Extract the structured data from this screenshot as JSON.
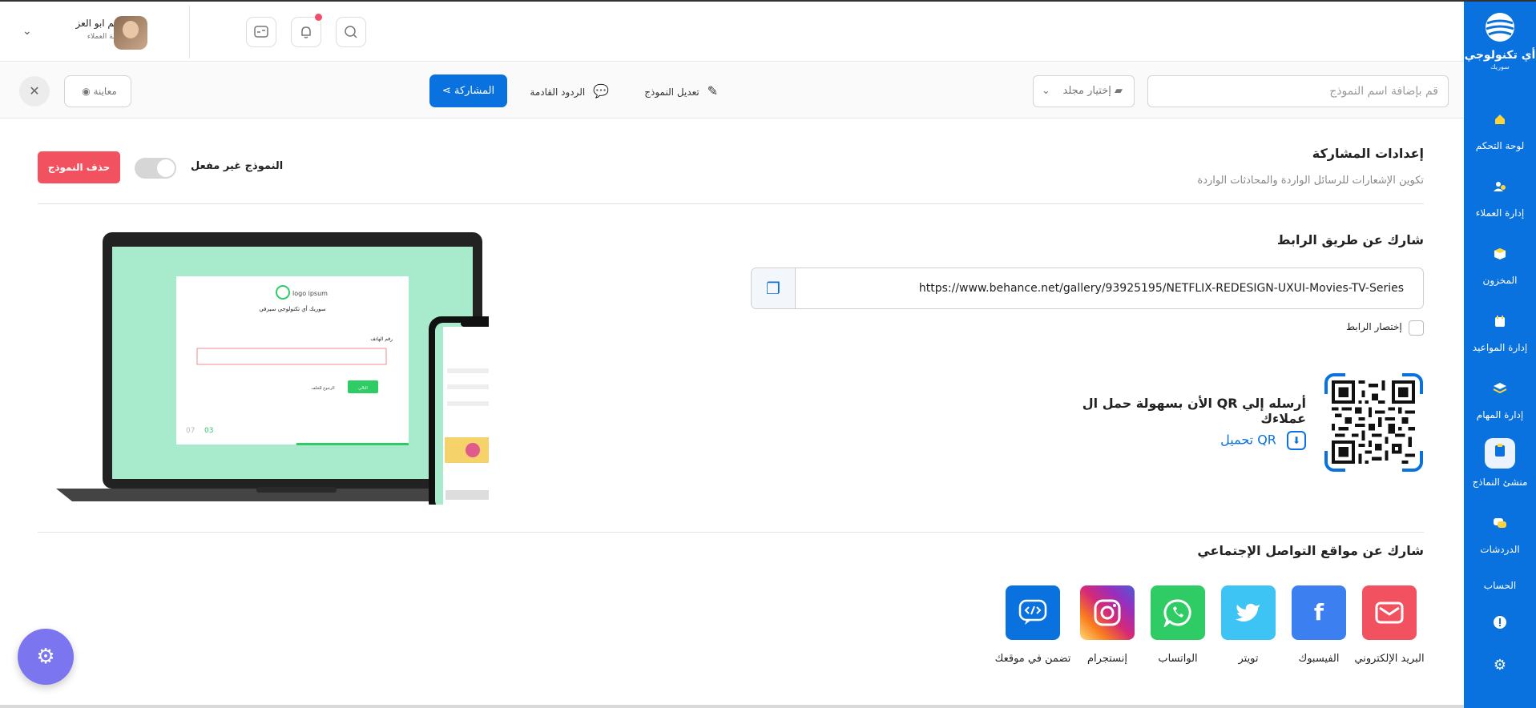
{
  "sidebar": {
    "logo_title": "أي تكنولوجي",
    "logo_sub": "سوريك",
    "items": [
      {
        "label": "لوحة التحكم",
        "icon": "home-icon"
      },
      {
        "label": "إدارة العملاء",
        "icon": "users-icon"
      },
      {
        "label": "المخزون",
        "icon": "box-icon"
      },
      {
        "label": "إدارة المواعيد",
        "icon": "calendar-icon"
      },
      {
        "label": "إدارة المهام",
        "icon": "layers-icon"
      },
      {
        "label": "منشئ النماذج",
        "icon": "clipboard-icon"
      },
      {
        "label": "الدردشات",
        "icon": "chat-icon"
      },
      {
        "label": "الحساب",
        "icon": ""
      }
    ],
    "accent": "#0a72de"
  },
  "header": {
    "user_name": "هيثم ابو العز",
    "user_role": "خدمة العملاء"
  },
  "toolbar": {
    "preview_label": "معاينة",
    "share_label": "المشاركة",
    "upcoming_replies_label": "الردود القادمة",
    "edit_form_label": "تعديل النموذج",
    "folder_label": "إختيار مجلد",
    "name_placeholder": "قم بإضافة اسم النموذج"
  },
  "settings": {
    "title": "إعدادات المشاركة",
    "subtitle": "تكوين الإشعارات للرسائل الواردة والمحادثات الواردة",
    "toggle_label": "النموذج غير مفعل",
    "toggle_on": false,
    "delete_label": "حذف النموذج",
    "delete_color": "#f2525f"
  },
  "link_share": {
    "title": "شارك عن طريق الرابط",
    "url": "https://www.behance.net/gallery/93925195/NETFLIX-REDESIGN-UXUI-Movies-TV-Series",
    "shorten_label": "إختصار الرابط",
    "shorten_checked": false
  },
  "qr": {
    "text": "الأن بسهولة حمل ال QR أرسله إلي عملاءك",
    "download_label": "تحميل QR"
  },
  "mockup": {
    "logo_text": "logo ipsum",
    "form_title": "سوريك أي تكنولوجي سيرفي",
    "phone_label": "رقم الهاتف",
    "page_current": "03",
    "page_total": "07",
    "next_label": "التالي",
    "back_label": "الرجوع للخلف"
  },
  "social": {
    "title": "شارك عن مواقع التواصل الإجتماعي",
    "items": [
      {
        "label": "البريد الإلكتروني",
        "icon": "email-icon",
        "color": "#f2525f"
      },
      {
        "label": "الفيسبوك",
        "icon": "facebook-icon",
        "color": "#3b7ff0"
      },
      {
        "label": "تويتر",
        "icon": "twitter-icon",
        "color": "#3dc3f4"
      },
      {
        "label": "الواتساب",
        "icon": "whatsapp-icon",
        "color": "#2fcc66"
      },
      {
        "label": "إنستجرام",
        "icon": "instagram-icon",
        "color": "#c13584"
      },
      {
        "label": "تضمن في موقعك",
        "icon": "embed-icon",
        "color": "#0a72de"
      }
    ]
  }
}
